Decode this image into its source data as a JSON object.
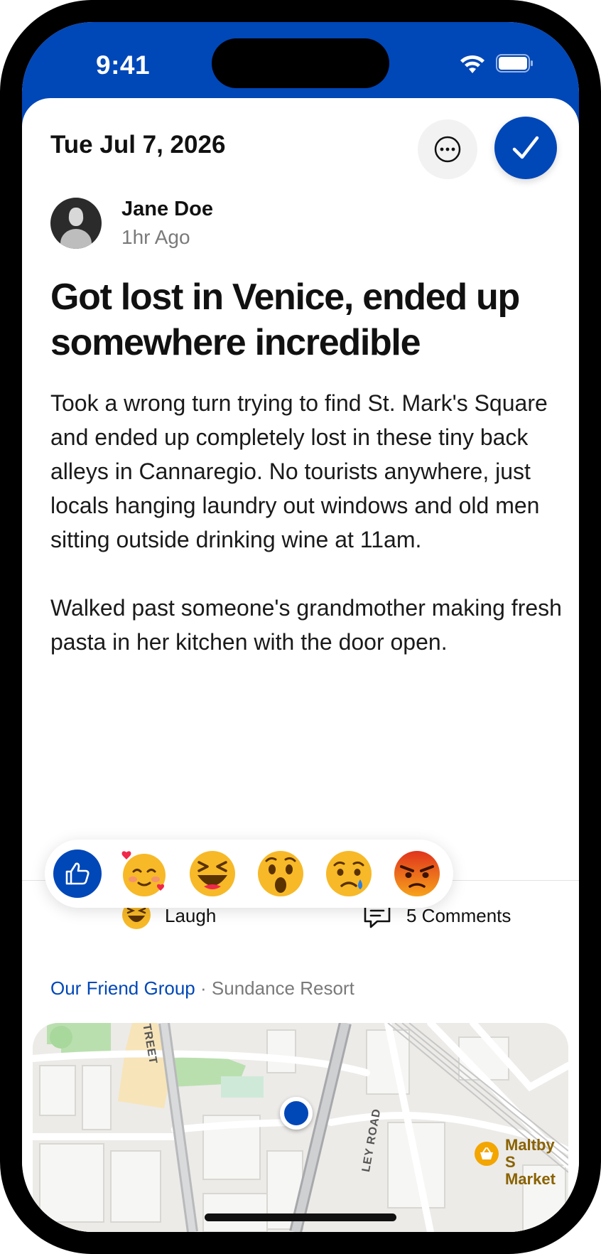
{
  "status_bar": {
    "time": "9:41",
    "icons": [
      "wifi-icon",
      "battery-icon"
    ],
    "background": "#0047b8"
  },
  "header": {
    "date": "Tue Jul 7, 2026",
    "more_icon": "ellipsis-circle-icon",
    "confirm_icon": "checkmark-icon",
    "accent": "#0047b8"
  },
  "author": {
    "name": "Jane Doe",
    "time_ago": "1hr Ago"
  },
  "post": {
    "title": "Got lost in Venice, ended up somewhere incredible",
    "paragraphs": [
      "Took a wrong turn trying to find St. Mark's Square and ended up completely lost in these tiny back alleys in Cannaregio. No tourists anywhere, just locals hanging laundry out windows and old men sitting outside drinking wine at 11am.",
      "Walked past someone's grandmother making fresh pasta in her kitchen with the door open."
    ]
  },
  "reactions": {
    "options": [
      "like-icon",
      "love-emoji-icon",
      "laugh-emoji-icon",
      "wow-emoji-icon",
      "sad-emoji-icon",
      "angry-emoji-icon"
    ],
    "current_reaction": "Laugh",
    "comments": "5 Comments"
  },
  "location": {
    "group": "Our Friend Group",
    "separator": "·",
    "place": "Sundance Resort"
  },
  "map": {
    "street_1": "TREET",
    "street_2": "LEY ROAD",
    "poi_name_line1": "Maltby S",
    "poi_name_line2": "Market",
    "poi_icon": "basket-icon"
  }
}
